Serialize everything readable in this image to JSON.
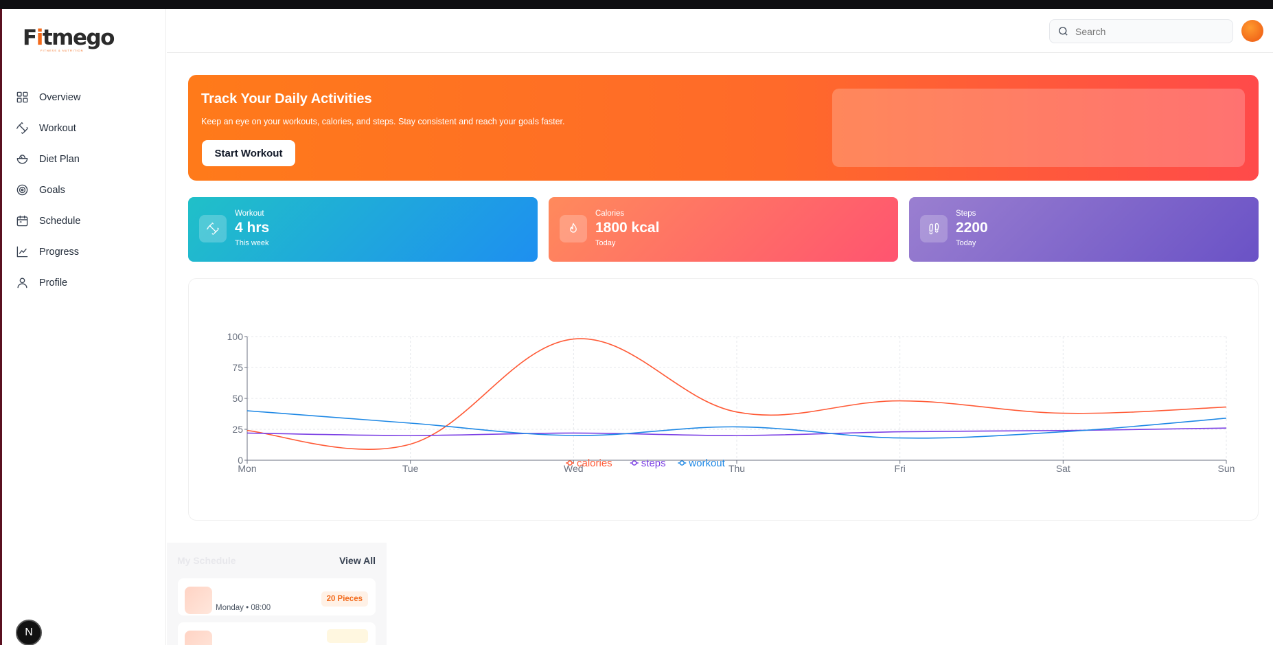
{
  "brand": {
    "logo_prefix": "F",
    "logo_accent": "i",
    "logo_rest": "tmego",
    "tagline": "FITNESS & NUTRITION"
  },
  "sidebar": {
    "items": [
      {
        "label": "Overview",
        "icon": "grid-icon"
      },
      {
        "label": "Workout",
        "icon": "dumbbell-icon"
      },
      {
        "label": "Diet Plan",
        "icon": "salad-icon"
      },
      {
        "label": "Goals",
        "icon": "target-icon"
      },
      {
        "label": "Schedule",
        "icon": "calendar-icon"
      },
      {
        "label": "Progress",
        "icon": "chart-line-icon"
      },
      {
        "label": "Profile",
        "icon": "user-icon"
      }
    ],
    "badge": "N"
  },
  "header": {
    "search_placeholder": "Search"
  },
  "hero": {
    "title": "Track Your Daily Activities",
    "subtitle": "Keep an eye on your workouts, calories, and steps. Stay consistent and reach your goals faster.",
    "button": "Start Workout"
  },
  "stats": [
    {
      "label": "Workout",
      "value": "4 hrs",
      "sub": "This week",
      "icon": "dumbbell-icon"
    },
    {
      "label": "Calories",
      "value": "1800 kcal",
      "sub": "Today",
      "icon": "flame-icon"
    },
    {
      "label": "Steps",
      "value": "2200",
      "sub": "Today",
      "icon": "footprints-icon"
    }
  ],
  "colors": {
    "calories": "#ff5a36",
    "steps": "#7b3fe4",
    "workout": "#1e88e5",
    "accent": "#f26a1b"
  },
  "chart_data": {
    "type": "line",
    "categories": [
      "Mon",
      "Tue",
      "Wed",
      "Thu",
      "Fri",
      "Sat",
      "Sun"
    ],
    "ylim": [
      0,
      100
    ],
    "yticks": [
      "0",
      "25",
      "50",
      "75",
      "100"
    ],
    "grid": true,
    "legend": "bottom-center",
    "series": [
      {
        "name": "calories",
        "values": [
          24,
          13,
          98,
          39,
          48,
          38,
          43
        ]
      },
      {
        "name": "steps",
        "values": [
          22,
          20,
          22,
          20,
          23,
          24,
          26
        ]
      },
      {
        "name": "workout",
        "values": [
          40,
          30,
          20,
          27,
          18,
          23,
          34
        ]
      }
    ]
  },
  "schedule": {
    "title": "My Schedule",
    "view_all": "View All",
    "items": [
      {
        "time": "Monday • 08:00",
        "badge": "20 Pieces"
      }
    ]
  }
}
